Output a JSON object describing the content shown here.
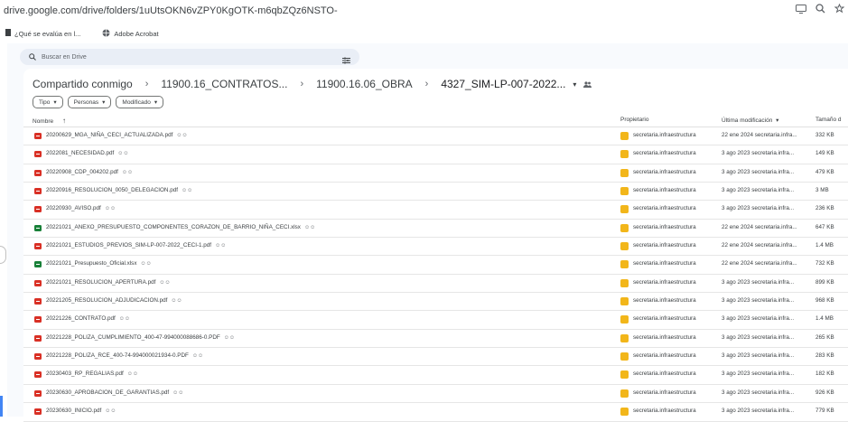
{
  "browser": {
    "url": "drive.google.com/drive/folders/1uUtsOKN6vZPY0KgOTK-m6qbZQz6NSTO-",
    "bookmarks": [
      {
        "label": "¿Qué se evalúa en l...",
        "icon": "bookmark-folder-icon"
      },
      {
        "label": "Adobe Acrobat",
        "icon": "globe-icon"
      }
    ]
  },
  "search": {
    "placeholder": "Buscar en Drive"
  },
  "breadcrumb": {
    "items": [
      "Compartido conmigo",
      "11900.16_CONTRATOS...",
      "11900.16.06_OBRA",
      "4327_SIM-LP-007-2022..."
    ]
  },
  "filters": [
    "Tipo",
    "Personas",
    "Modificado"
  ],
  "columns": {
    "name": "Nombre",
    "owner": "Propietario",
    "modified": "Última modificación",
    "size": "Tamaño d"
  },
  "files": [
    {
      "name": "20200629_MGA_NIÑA_CECI_ACTUALIZADA.pdf",
      "type": "pdf",
      "owner": "secretaria.infraestructura",
      "modified": "22 ene 2024 secretaria.infra...",
      "size": "332 KB"
    },
    {
      "name": "2022081_NECESIDAD.pdf",
      "type": "pdf",
      "owner": "secretaria.infraestructura",
      "modified": "3 ago 2023 secretaria.infra...",
      "size": "149 KB"
    },
    {
      "name": "20220908_CDP_004202.pdf",
      "type": "pdf",
      "owner": "secretaria.infraestructura",
      "modified": "3 ago 2023 secretaria.infra...",
      "size": "479 KB"
    },
    {
      "name": "20220916_RESOLUCION_0050_DELEGACION.pdf",
      "type": "pdf",
      "owner": "secretaria.infraestructura",
      "modified": "3 ago 2023 secretaria.infra...",
      "size": "3 MB"
    },
    {
      "name": "20220930_AVISO.pdf",
      "type": "pdf",
      "owner": "secretaria.infraestructura",
      "modified": "3 ago 2023 secretaria.infra...",
      "size": "236 KB"
    },
    {
      "name": "20221021_ANEXO_PRESUPUESTO_COMPONENTES_CORAZON_DE_BARRIO_NIÑA_CECI.xlsx",
      "type": "xlsx",
      "owner": "secretaria.infraestructura",
      "modified": "22 ene 2024 secretaria.infra...",
      "size": "647 KB"
    },
    {
      "name": "20221021_ESTUDIOS_PREVIOS_SIM-LP-007-2022_CECI-1.pdf",
      "type": "pdf",
      "owner": "secretaria.infraestructura",
      "modified": "22 ene 2024 secretaria.infra...",
      "size": "1.4 MB"
    },
    {
      "name": "20221021_Presupuesto_Oficial.xlsx",
      "type": "xlsx",
      "owner": "secretaria.infraestructura",
      "modified": "22 ene 2024 secretaria.infra...",
      "size": "732 KB"
    },
    {
      "name": "20221021_RESOLUCION_APERTURA.pdf",
      "type": "pdf",
      "owner": "secretaria.infraestructura",
      "modified": "3 ago 2023 secretaria.infra...",
      "size": "899 KB"
    },
    {
      "name": "20221205_RESOLUCION_ADJUDICACION.pdf",
      "type": "pdf",
      "owner": "secretaria.infraestructura",
      "modified": "3 ago 2023 secretaria.infra...",
      "size": "968 KB"
    },
    {
      "name": "20221226_CONTRATO.pdf",
      "type": "pdf",
      "owner": "secretaria.infraestructura",
      "modified": "3 ago 2023 secretaria.infra...",
      "size": "1.4 MB"
    },
    {
      "name": "20221228_POLIZA_CUMPLIMIENTO_400-47-994000088686-0.PDF",
      "type": "pdf",
      "owner": "secretaria.infraestructura",
      "modified": "3 ago 2023 secretaria.infra...",
      "size": "265 KB"
    },
    {
      "name": "20221228_POLIZA_RCE_400-74-994000021934-0.PDF",
      "type": "pdf",
      "owner": "secretaria.infraestructura",
      "modified": "3 ago 2023 secretaria.infra...",
      "size": "283 KB"
    },
    {
      "name": "20230403_RP_REGALIAS.pdf",
      "type": "pdf",
      "owner": "secretaria.infraestructura",
      "modified": "3 ago 2023 secretaria.infra...",
      "size": "182 KB"
    },
    {
      "name": "20230630_APROBACION_DE_GARANTIAS.pdf",
      "type": "pdf",
      "owner": "secretaria.infraestructura",
      "modified": "3 ago 2023 secretaria.infra...",
      "size": "926 KB"
    },
    {
      "name": "20230630_INICIO.pdf",
      "type": "pdf",
      "owner": "secretaria.infraestructura",
      "modified": "3 ago 2023 secretaria.infra...",
      "size": "779 KB"
    }
  ],
  "colors": {
    "pdf": "#d93025",
    "xlsx": "#188038",
    "owner_avatar": "#f2b61a",
    "search_bg": "#e9eef6",
    "app_bg": "#f8fafd"
  },
  "icons": {
    "shared": "people-icon",
    "sort": "arrow-up-icon",
    "chip_arrow": "chevron-down-icon"
  }
}
